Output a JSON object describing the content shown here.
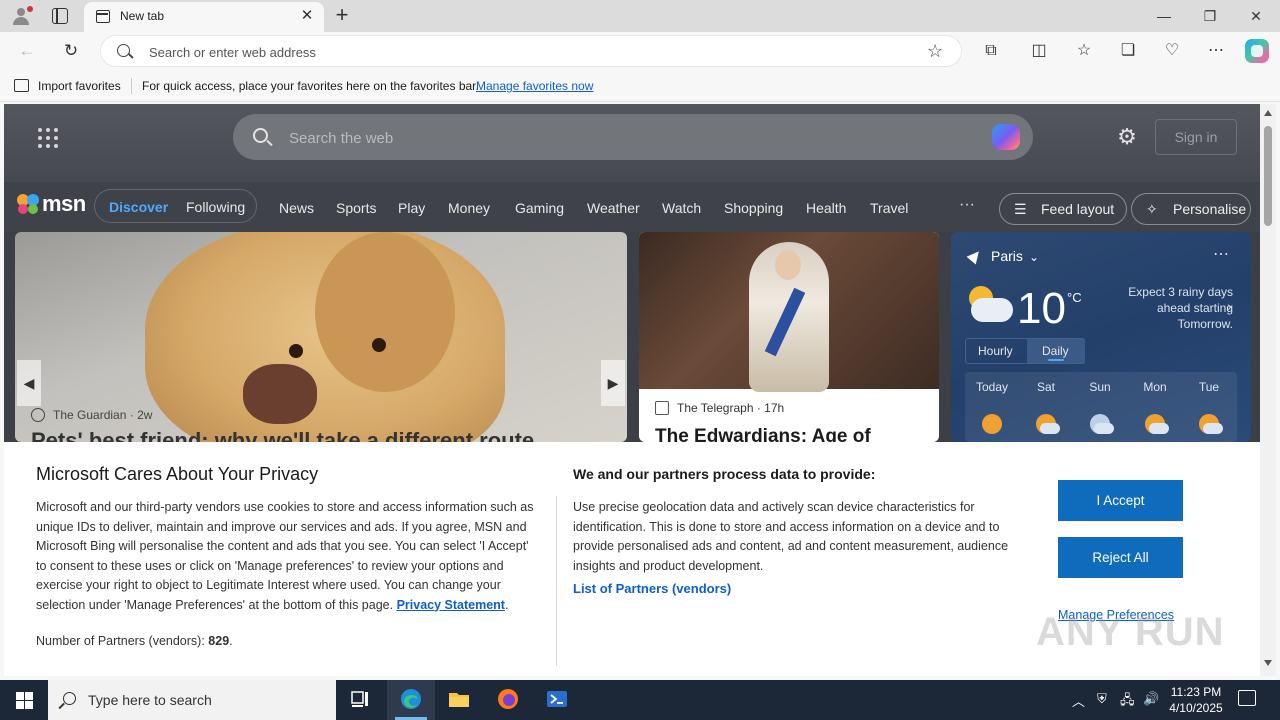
{
  "browser": {
    "tab_title": "New tab",
    "omnibox_placeholder": "Search or enter web address",
    "favorites_bar": {
      "import_label": "Import favorites",
      "message": "For quick access, place your favorites here on the favorites bar.",
      "link": "Manage favorites now"
    }
  },
  "msn": {
    "search_placeholder": "Search the web",
    "sign_in": "Sign in",
    "logo_text": "msn",
    "feed_toggle": [
      "Discover",
      "Following"
    ],
    "nav": [
      "News",
      "Sports",
      "Play",
      "Money",
      "Gaming",
      "Weather",
      "Watch",
      "Shopping",
      "Health",
      "Travel"
    ],
    "more": "···",
    "feed_layout": "Feed layout",
    "personalise": "Personalise",
    "hero": {
      "source": "The Guardian",
      "age": "2w",
      "headline": "Pets' best friend: why we'll take a different route"
    },
    "card2": {
      "source": "The Telegraph",
      "age": "17h",
      "headline": "The Edwardians: Age of"
    },
    "weather": {
      "location": "Paris",
      "temp": "10",
      "unit": "°C",
      "message": "Expect 3 rainy days ahead starting Tomorrow.",
      "tabs": [
        "Hourly",
        "Daily"
      ],
      "active_tab": "Daily",
      "days": [
        "Today",
        "Sat",
        "Sun",
        "Mon",
        "Tue"
      ]
    }
  },
  "privacy": {
    "title": "Microsoft Cares About Your Privacy",
    "body": "Microsoft and our third-party vendors use cookies to store and access information such as unique IDs to deliver, maintain and improve our services and ads. If you agree, MSN and Microsoft Bing will personalise the content and ads that you see. You can select 'I Accept' to consent to these uses or click on 'Manage preferences' to review your options and exercise your right to object to Legitimate Interest where used.  You can change your selection under 'Manage Preferences' at the bottom of this page.",
    "privacy_link": "Privacy Statement",
    "partners_label": "Number of Partners (vendors):",
    "partners_count": "829",
    "right_title": "We and our partners process data to provide:",
    "right_body": "Use precise geolocation data and actively scan device characteristics for identification. This is done to store and access information on a device and to provide personalised ads and content, ad and content measurement, audience insights and product development.",
    "vendors_link": "List of Partners (vendors)",
    "accept": "I Accept",
    "reject": "Reject All",
    "manage": "Manage Preferences"
  },
  "watermark": "ANY RUN",
  "taskbar": {
    "search_placeholder": "Type here to search",
    "time": "11:23 PM",
    "date": "4/10/2025"
  },
  "colors": {
    "accent": "#0f6cbd",
    "link": "#0f5fc8",
    "taskbar": "#1c2737"
  }
}
